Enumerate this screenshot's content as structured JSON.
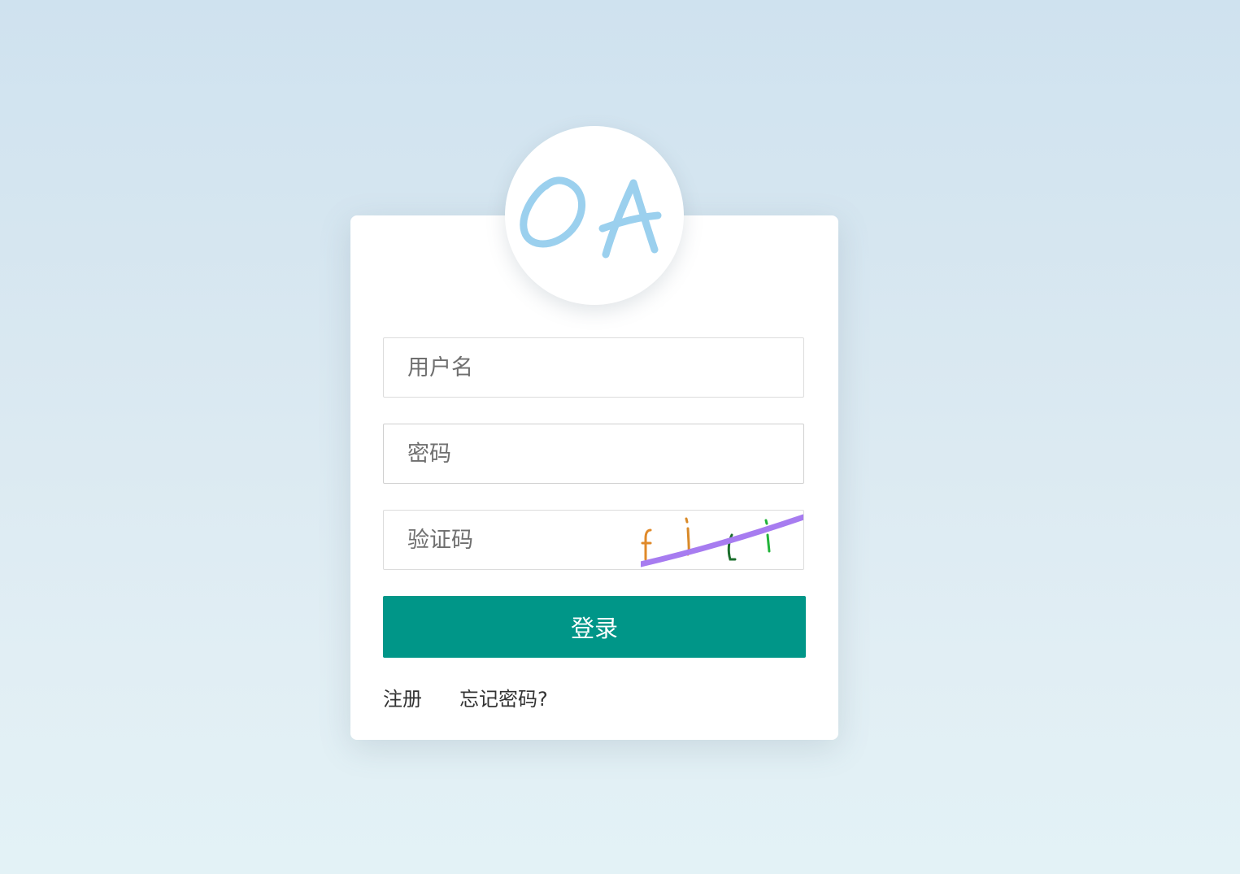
{
  "logo": {
    "text": "OA",
    "color": "#9bd0ee",
    "icon": "oa-logo-icon"
  },
  "form": {
    "username": {
      "placeholder": "用户名",
      "value": ""
    },
    "password": {
      "placeholder": "密码",
      "value": ""
    },
    "captcha": {
      "placeholder": "验证码",
      "value": "",
      "image_text": "fiti",
      "char_colors": [
        "#e08a2a",
        "#d98a28",
        "#1b6e2c",
        "#22b43a"
      ],
      "strike_color": "#a77cf0"
    },
    "login_label": "登录",
    "login_color": "#009688"
  },
  "links": {
    "register_label": "注册",
    "forgot_label": "忘记密码?"
  }
}
